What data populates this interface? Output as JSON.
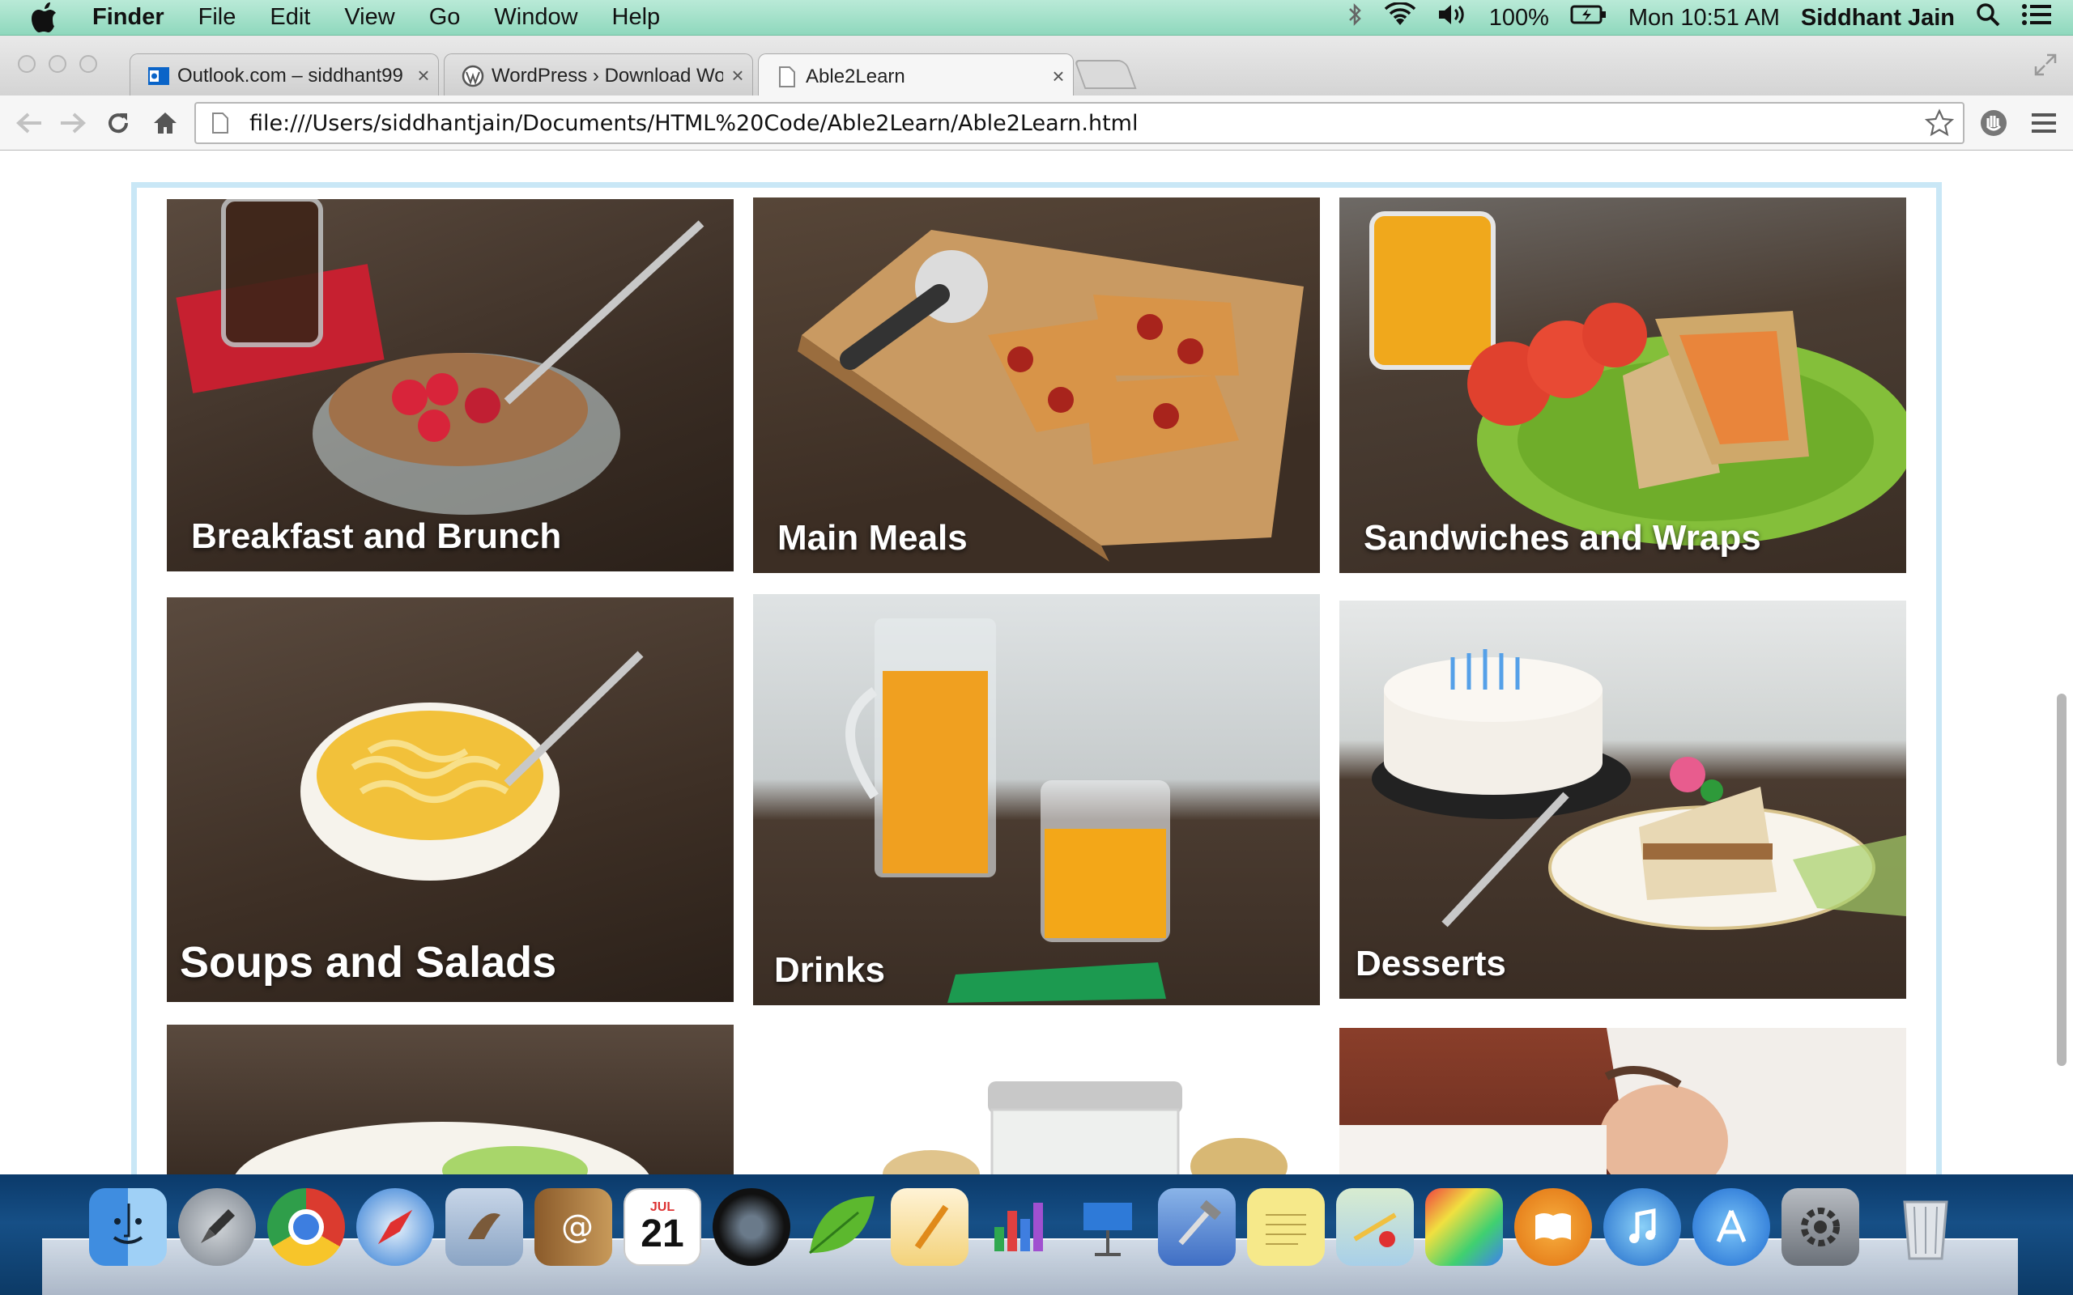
{
  "menubar": {
    "app_name": "Finder",
    "menus": [
      "File",
      "Edit",
      "View",
      "Go",
      "Window",
      "Help"
    ],
    "battery_percent": "100%",
    "clock": "Mon 10:51 AM",
    "user": "Siddhant Jain",
    "icons": [
      "apple-icon",
      "bluetooth-icon",
      "wifi-icon",
      "volume-icon",
      "battery-icon",
      "spotlight-icon",
      "notification-center-icon"
    ]
  },
  "browser": {
    "tabs": [
      {
        "title": "Outlook.com – siddhant99",
        "icon": "outlook-icon"
      },
      {
        "title": "WordPress › Download Wor",
        "icon": "wordpress-icon"
      },
      {
        "title": "Able2Learn",
        "icon": "page-icon"
      }
    ],
    "close_glyph": "×",
    "url": "file:///Users/siddhantjain/Documents/HTML%20Code/Able2Learn/Able2Learn.html"
  },
  "page": {
    "categories": [
      {
        "label": "Breakfast and Brunch"
      },
      {
        "label": "Main Meals"
      },
      {
        "label": "Sandwiches and Wraps"
      },
      {
        "label": "Soups and Salads"
      },
      {
        "label": "Drinks"
      },
      {
        "label": "Desserts"
      }
    ]
  },
  "dock": {
    "apps": [
      "finder-icon",
      "launchpad-icon",
      "chrome-icon",
      "safari-icon",
      "mail-icon",
      "contacts-icon",
      "calendar-icon",
      "facetime-icon",
      "evernote-icon",
      "pages-icon",
      "numbers-icon",
      "keynote-icon",
      "xcode-icon",
      "notes-icon",
      "maps-icon",
      "grapher-icon",
      "ibooks-icon",
      "itunes-icon",
      "app-store-icon",
      "system-preferences-icon",
      "trash-icon"
    ],
    "calendar_month": "JUL",
    "calendar_day": "21"
  }
}
